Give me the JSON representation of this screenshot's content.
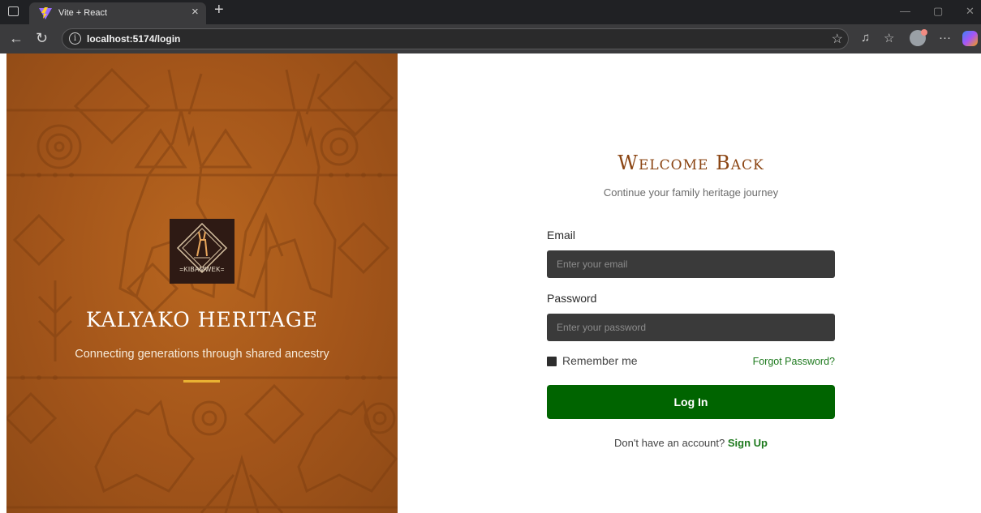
{
  "browser": {
    "tab_title": "Vite + React",
    "new_tab_label": "+",
    "url": "localhost:5174/login",
    "window_controls": [
      "—",
      "▢",
      "✕"
    ]
  },
  "hero": {
    "logo_text": "=KIBAMWEK=",
    "brand": "KALYAKO HERITAGE",
    "tagline": "Connecting generations through shared ancestry",
    "background_color": "#a3551a",
    "accent_color": "#e9b233"
  },
  "login": {
    "title": "Welcome Back",
    "subtitle": "Continue your family heritage journey",
    "email_label": "Email",
    "email_placeholder": "Enter your email",
    "password_label": "Password",
    "password_placeholder": "Enter your password",
    "remember_label": "Remember me",
    "forgot_label": "Forgot Password?",
    "login_button": "Log In",
    "no_account_text": "Don't have an account?",
    "signup_label": "Sign Up",
    "primary_color": "#006400",
    "title_color": "#8b4513"
  }
}
